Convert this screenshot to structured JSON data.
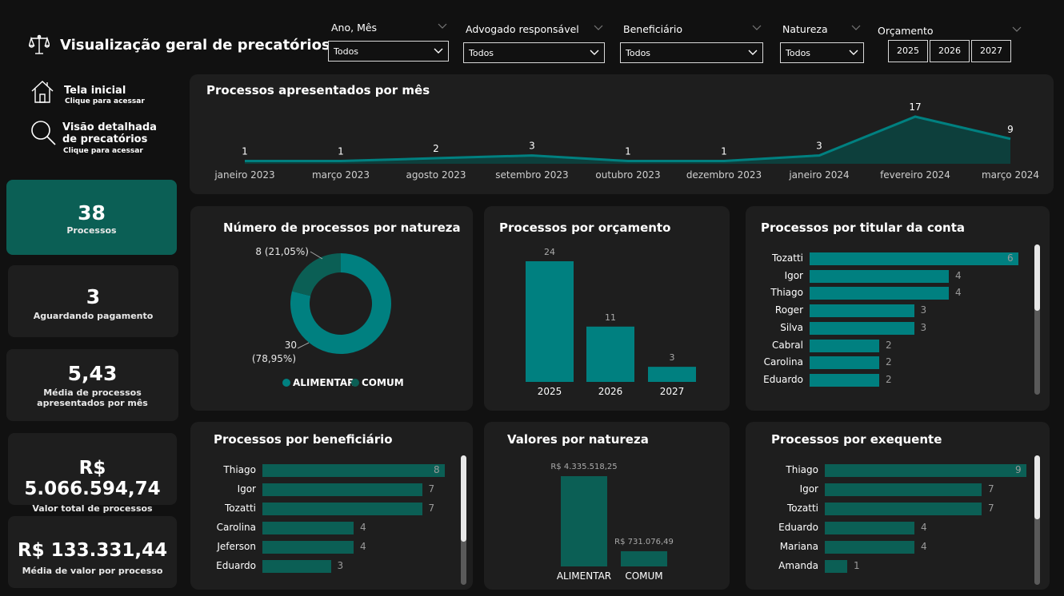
{
  "header": {
    "title": "Visualização geral de precatórios",
    "logo_icon": "scales-icon"
  },
  "filters": {
    "ano_mes": {
      "label": "Ano, Mês",
      "value": "Todos"
    },
    "advogado": {
      "label": "Advogado responsável",
      "value": "Todos"
    },
    "beneficiario": {
      "label": "Beneficiário",
      "value": "Todos"
    },
    "natureza": {
      "label": "Natureza",
      "value": "Todos"
    },
    "orcamento": {
      "label": "Orçamento",
      "years": [
        "2025",
        "2026",
        "2027"
      ]
    }
  },
  "nav": {
    "home": {
      "title": "Tela inicial",
      "sub": "Clique para acessar",
      "icon": "home-icon"
    },
    "detail": {
      "title1": "Visão detalhada",
      "title2": "de precatórios",
      "sub": "Clique para acessar",
      "icon": "search-icon"
    }
  },
  "kpis": [
    {
      "value": "38",
      "label1": "Processos",
      "label2": ""
    },
    {
      "value": "3",
      "label1": "Aguardando pagamento",
      "label2": ""
    },
    {
      "value": "5,43",
      "label1": "Média de processos",
      "label2": "apresentados por mês"
    },
    {
      "value": "R$ 5.066.594,74",
      "label1": "Valor total de processos",
      "label2": ""
    },
    {
      "value": "R$ 133.331,44",
      "label1": "Média de valor por processo",
      "label2": ""
    }
  ],
  "colors": {
    "teal": "#008080",
    "dark_teal": "#0b5f55",
    "panel": "#1e1e1e",
    "bg": "#111111"
  },
  "charts": {
    "line_title": "Processos apresentados por mês",
    "donut_title": "Número de processos por natureza",
    "orc_title": "Processos por orçamento",
    "titular_title": "Processos por titular da conta",
    "benef_title": "Processos por beneficiário",
    "valores_title": "Valores por natureza",
    "exeq_title": "Processos por exequente"
  },
  "chart_data": [
    {
      "type": "area",
      "id": "monthly",
      "x": [
        "janeiro 2023",
        "março 2023",
        "agosto 2023",
        "setembro 2023",
        "outubro 2023",
        "dezembro 2023",
        "janeiro 2024",
        "fevereiro 2024",
        "março 2024"
      ],
      "values": [
        1,
        1,
        2,
        3,
        1,
        1,
        3,
        17,
        9
      ],
      "title": "Processos apresentados por mês"
    },
    {
      "type": "pie",
      "id": "natureza",
      "categories": [
        "ALIMENTAR",
        "COMUM"
      ],
      "values": [
        30,
        8
      ],
      "labels": [
        "30 (78,95%)",
        "8 (21,05%)"
      ],
      "label_alimentar_1": "30",
      "label_alimentar_2": "(78,95%)",
      "label_comum": "8 (21,05%)",
      "colors": [
        "#008080",
        "#0b5f55"
      ],
      "legend": "bottom"
    },
    {
      "type": "bar",
      "id": "orcamento",
      "categories": [
        "2025",
        "2026",
        "2027"
      ],
      "values": [
        24,
        11,
        3
      ]
    },
    {
      "type": "bar",
      "orientation": "horizontal",
      "id": "titular",
      "categories": [
        "Tozatti",
        "Igor",
        "Thiago",
        "Roger",
        "Silva",
        "Cabral",
        "Carolina",
        "Eduardo"
      ],
      "values": [
        6,
        4,
        4,
        3,
        3,
        2,
        2,
        2
      ]
    },
    {
      "type": "bar",
      "orientation": "horizontal",
      "id": "beneficiario",
      "categories": [
        "Thiago",
        "Igor",
        "Tozatti",
        "Carolina",
        "Jeferson",
        "Eduardo"
      ],
      "values": [
        8,
        7,
        7,
        4,
        4,
        3
      ]
    },
    {
      "type": "bar",
      "id": "valores",
      "categories": [
        "ALIMENTAR",
        "COMUM"
      ],
      "values": [
        4335518.25,
        731076.49
      ],
      "labels": [
        "R$ 4.335.518,25",
        "R$ 731.076,49"
      ]
    },
    {
      "type": "bar",
      "orientation": "horizontal",
      "id": "exequente",
      "categories": [
        "Thiago",
        "Igor",
        "Tozatti",
        "Eduardo",
        "Mariana",
        "Amanda"
      ],
      "values": [
        9,
        7,
        7,
        4,
        4,
        1
      ]
    }
  ]
}
